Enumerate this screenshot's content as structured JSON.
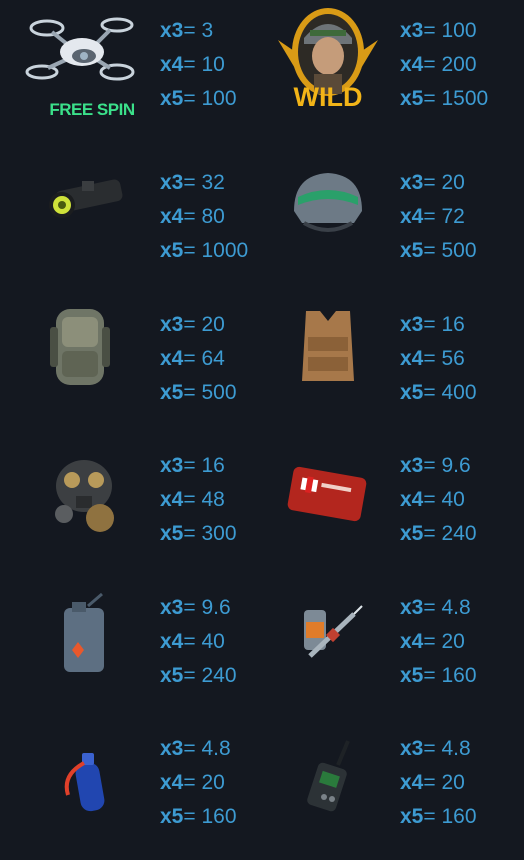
{
  "symbols": [
    {
      "name": "free-spin-drone",
      "label": "FREE SPIN",
      "icon": "drone-icon",
      "pays": [
        {
          "m": "x3",
          "v": "3"
        },
        {
          "m": "x4",
          "v": "10"
        },
        {
          "m": "x5",
          "v": "100"
        }
      ]
    },
    {
      "name": "wild-soldier",
      "label": "WILD",
      "icon": "soldier-icon",
      "pays": [
        {
          "m": "x3",
          "v": "100"
        },
        {
          "m": "x4",
          "v": "200"
        },
        {
          "m": "x5",
          "v": "1500"
        }
      ]
    },
    {
      "name": "scope",
      "icon": "scope-icon",
      "pays": [
        {
          "m": "x3",
          "v": "32"
        },
        {
          "m": "x4",
          "v": "80"
        },
        {
          "m": "x5",
          "v": "1000"
        }
      ]
    },
    {
      "name": "helmet",
      "icon": "helmet-icon",
      "pays": [
        {
          "m": "x3",
          "v": "20"
        },
        {
          "m": "x4",
          "v": "72"
        },
        {
          "m": "x5",
          "v": "500"
        }
      ]
    },
    {
      "name": "backpack",
      "icon": "backpack-icon",
      "pays": [
        {
          "m": "x3",
          "v": "20"
        },
        {
          "m": "x4",
          "v": "64"
        },
        {
          "m": "x5",
          "v": "500"
        }
      ]
    },
    {
      "name": "vest",
      "icon": "vest-icon",
      "pays": [
        {
          "m": "x3",
          "v": "16"
        },
        {
          "m": "x4",
          "v": "56"
        },
        {
          "m": "x5",
          "v": "400"
        }
      ]
    },
    {
      "name": "gas-mask",
      "icon": "gas-mask-icon",
      "pays": [
        {
          "m": "x3",
          "v": "16"
        },
        {
          "m": "x4",
          "v": "48"
        },
        {
          "m": "x5",
          "v": "300"
        }
      ]
    },
    {
      "name": "first-aid-kit",
      "icon": "first-aid-kit-icon",
      "pays": [
        {
          "m": "x3",
          "v": "9.6"
        },
        {
          "m": "x4",
          "v": "40"
        },
        {
          "m": "x5",
          "v": "240"
        }
      ]
    },
    {
      "name": "jerry-can",
      "icon": "jerry-can-icon",
      "pays": [
        {
          "m": "x3",
          "v": "9.6"
        },
        {
          "m": "x4",
          "v": "40"
        },
        {
          "m": "x5",
          "v": "240"
        }
      ]
    },
    {
      "name": "syringe",
      "icon": "syringe-icon",
      "pays": [
        {
          "m": "x3",
          "v": "4.8"
        },
        {
          "m": "x4",
          "v": "20"
        },
        {
          "m": "x5",
          "v": "160"
        }
      ]
    },
    {
      "name": "energy-drink",
      "icon": "energy-drink-icon",
      "pays": [
        {
          "m": "x3",
          "v": "4.8"
        },
        {
          "m": "x4",
          "v": "20"
        },
        {
          "m": "x5",
          "v": "160"
        }
      ]
    },
    {
      "name": "walkie-talkie",
      "icon": "walkie-talkie-icon",
      "pays": [
        {
          "m": "x3",
          "v": "4.8"
        },
        {
          "m": "x4",
          "v": "20"
        },
        {
          "m": "x5",
          "v": "160"
        }
      ]
    }
  ],
  "equals_sign": "=",
  "colors": {
    "background": "#141820",
    "text": "#3d9bd2",
    "free_spin": "#3be08a",
    "wild": "#f2b418"
  }
}
